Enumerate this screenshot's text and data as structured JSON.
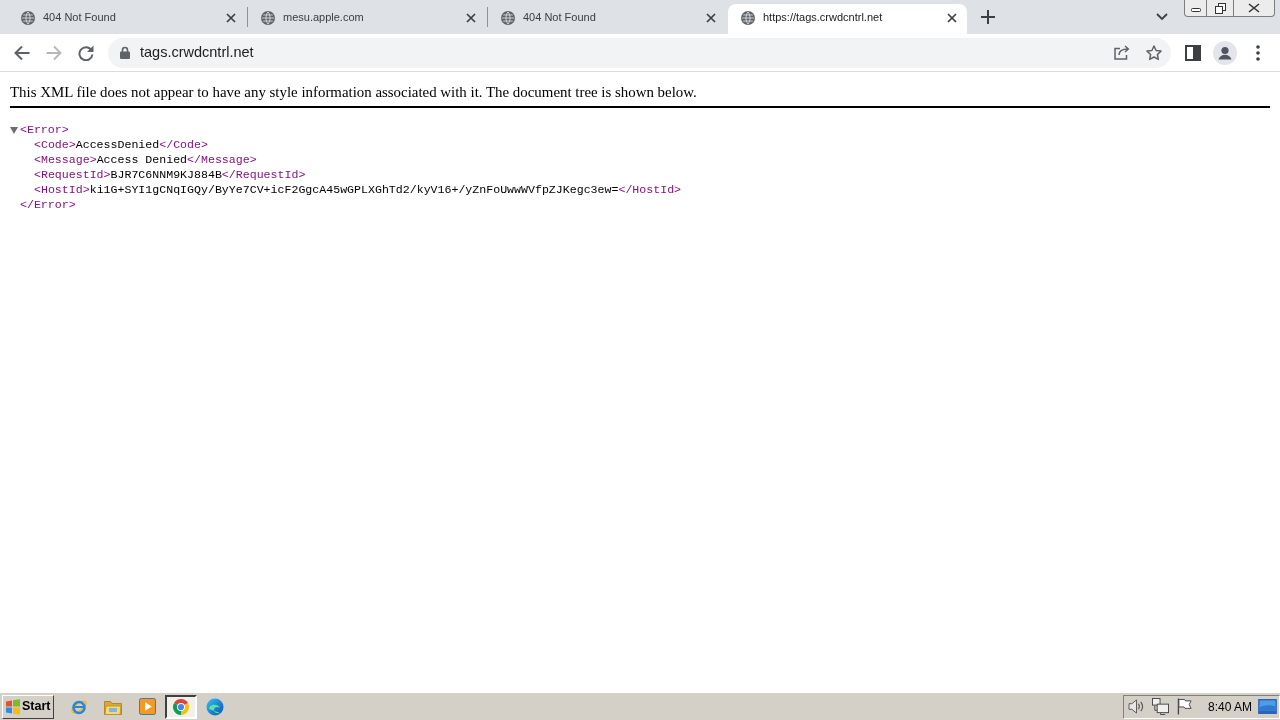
{
  "tabs": [
    {
      "title": "404 Not Found",
      "selected": false
    },
    {
      "title": "mesu.apple.com",
      "selected": false
    },
    {
      "title": "404 Not Found",
      "selected": false
    },
    {
      "title": "https://tags.crwdcntrl.net",
      "selected": true
    }
  ],
  "toolbar": {
    "nav_buttons": [
      {
        "kind": "back",
        "disabled": false
      },
      {
        "kind": "forward",
        "disabled": true
      },
      {
        "kind": "reload",
        "disabled": false
      }
    ],
    "address_bar": {
      "value": "tags.crwdcntrl.net"
    }
  },
  "page": {
    "notice": "This XML file does not appear to have any style information associated with it. The document tree is shown below.",
    "xml_root": {
      "open_tag": "<Error>",
      "close_tag": "</Error>",
      "expanded": true,
      "children": [
        {
          "open_tag": "<Code>",
          "text": "AccessDenied",
          "close_tag": "</Code>"
        },
        {
          "open_tag": "<Message>",
          "text": "Access Denied",
          "close_tag": "</Message>"
        },
        {
          "open_tag": "<RequestId>",
          "text": "BJR7C6NNM9KJ884B",
          "close_tag": "</RequestId>"
        },
        {
          "open_tag": "<HostId>",
          "text": "ki1G+SYI1gCNqIGQy/ByYe7CV+icF2GgcA45wGPLXGhTd2/kyV16+/yZnFoUwwWVfpZJKegc3ew=",
          "close_tag": "</HostId>"
        }
      ]
    }
  },
  "taskbar": {
    "start_label": "Start",
    "apps": [
      {
        "kind": "ie",
        "selected": false
      },
      {
        "kind": "folder",
        "selected": false
      },
      {
        "kind": "media",
        "selected": false
      },
      {
        "kind": "chrome",
        "selected": true
      },
      {
        "kind": "edge",
        "selected": false
      }
    ],
    "clock": "8:40 AM"
  }
}
